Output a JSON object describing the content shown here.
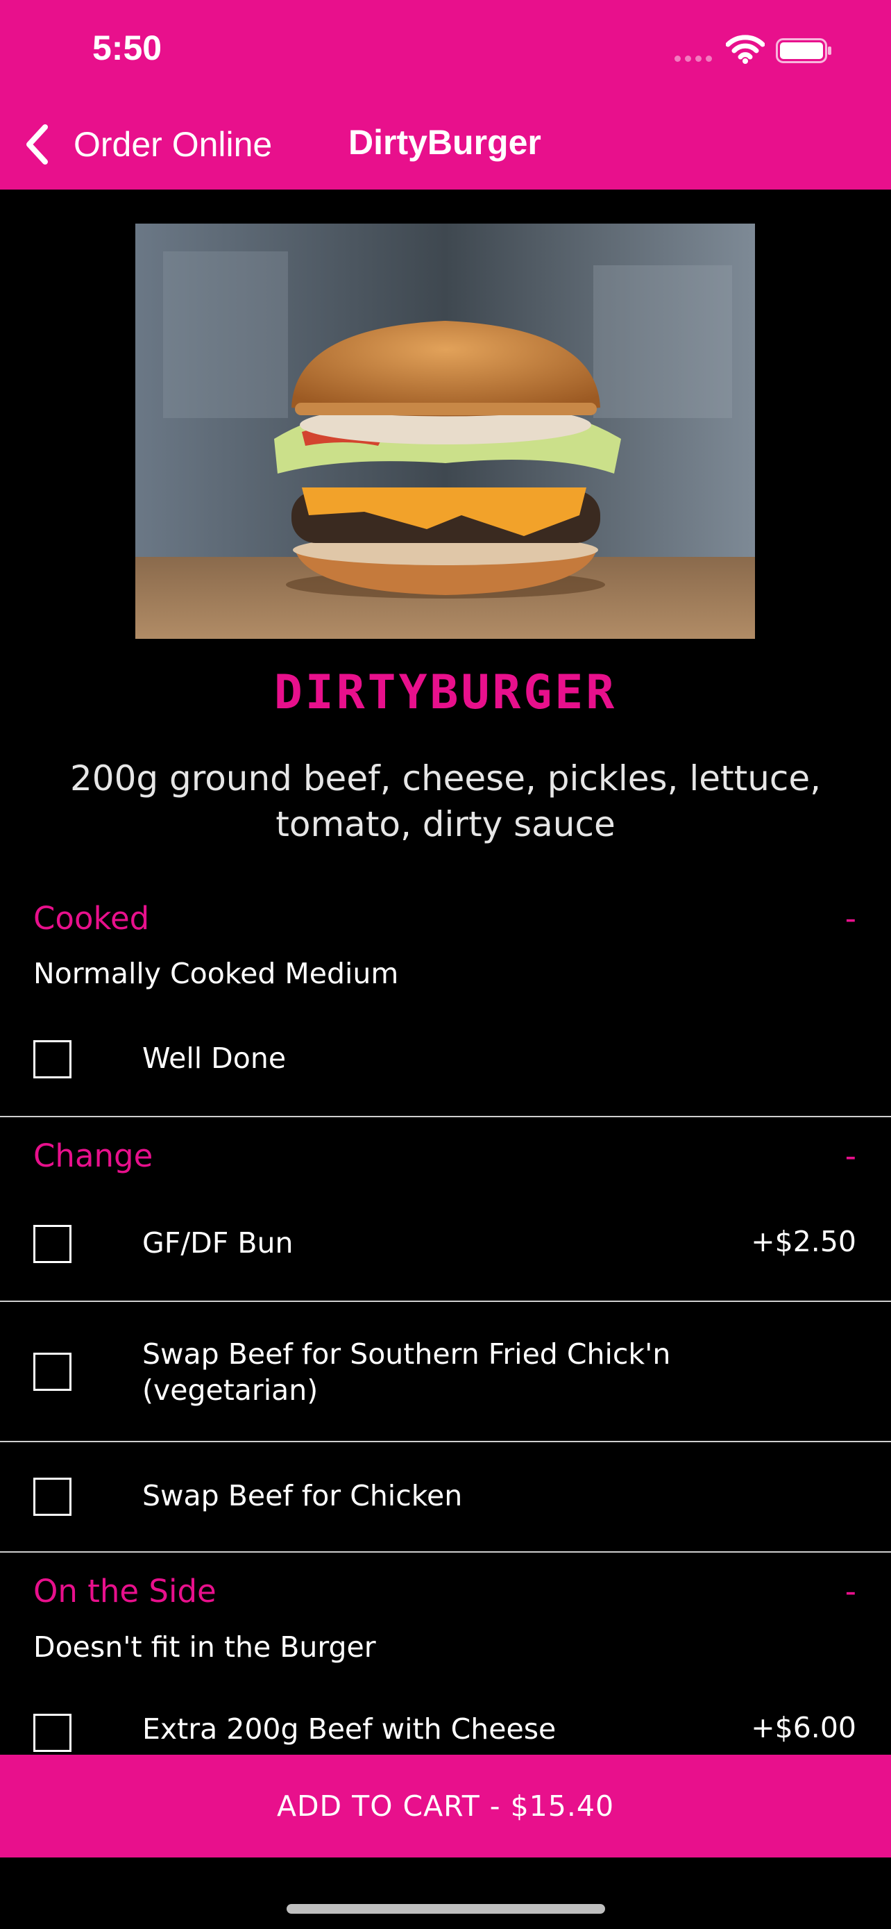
{
  "status_bar": {
    "time": "5:50"
  },
  "nav": {
    "back_label": "Order Online",
    "title": "DirtyBurger"
  },
  "item": {
    "name": "DIRTYBURGER",
    "description": "200g ground beef, cheese, pickles, lettuce, tomato, dirty sauce"
  },
  "sections": [
    {
      "title": "Cooked",
      "toggle": "-",
      "subtitle": "Normally Cooked Medium",
      "options": [
        {
          "label": "Well Done",
          "price": ""
        }
      ]
    },
    {
      "title": "Change",
      "toggle": "-",
      "subtitle": "",
      "options": [
        {
          "label": "GF/DF Bun",
          "price": "+$2.50"
        },
        {
          "label": "Swap Beef for Southern Fried Chick'n (vegetarian)",
          "price": ""
        },
        {
          "label": "Swap Beef for Chicken",
          "price": ""
        }
      ]
    },
    {
      "title": "On the Side",
      "toggle": "-",
      "subtitle": "Doesn't fit in the Burger",
      "options": [
        {
          "label": "Extra 200g Beef with Cheese",
          "price": "+$6.00"
        }
      ]
    }
  ],
  "cart": {
    "label": "ADD TO CART - $15.40"
  },
  "colors": {
    "accent": "#e8108c",
    "background": "#000000",
    "text": "#ffffff"
  }
}
